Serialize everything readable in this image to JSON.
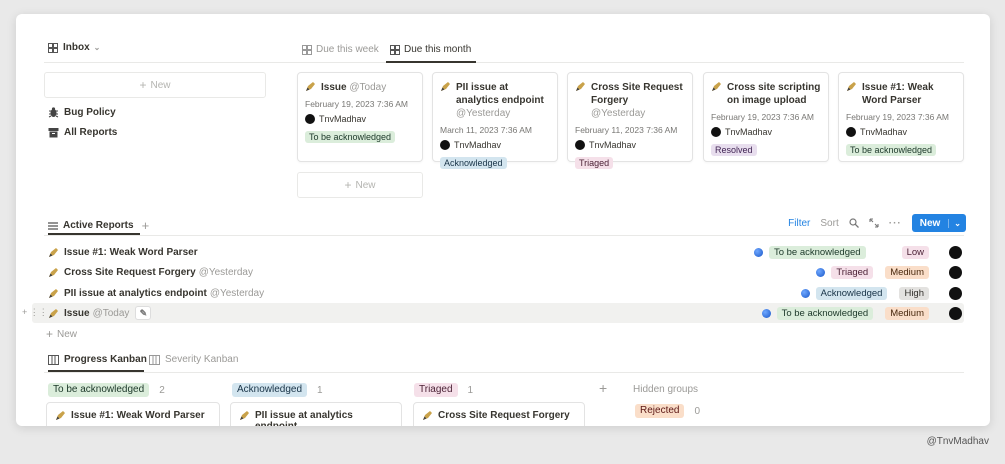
{
  "sidebar": {
    "view": "Inbox",
    "new_label": "New",
    "items": [
      {
        "label": "Bug Policy",
        "icon": "bug-icon"
      },
      {
        "label": "All Reports",
        "icon": "archive-box-icon"
      }
    ]
  },
  "due_tabs": [
    {
      "label": "Due this week",
      "active": false
    },
    {
      "label": "Due this month",
      "active": true
    }
  ],
  "cards": [
    {
      "title": "Issue",
      "mention": "@Today",
      "date": "February 19, 2023 7:36 AM",
      "user": "TnvMadhav",
      "tag": "To be acknowledged"
    },
    {
      "title": "PII issue at analytics endpoint",
      "mention": "@Yesterday",
      "date": "March 11, 2023 7:36 AM",
      "user": "TnvMadhav",
      "tag": "Acknowledged"
    },
    {
      "title": "Cross Site Request Forgery",
      "mention": "@Yesterday",
      "date": "February 11, 2023 7:36 AM",
      "user": "TnvMadhav",
      "tag": "Triaged"
    },
    {
      "title": "Cross site scripting on image upload",
      "mention": "",
      "date": "February 19, 2023 7:36 AM",
      "user": "TnvMadhav",
      "tag": "Resolved"
    },
    {
      "title": "Issue #1: Weak Word Parser",
      "mention": "",
      "date": "February 19, 2023 7:36 AM",
      "user": "TnvMadhav",
      "tag": "To be acknowledged"
    }
  ],
  "cards_new_label": "New",
  "active_reports": {
    "title": "Active Reports",
    "filter": "Filter",
    "sort": "Sort",
    "new_button": "New",
    "rows": [
      {
        "name": "Issue #1: Weak Word Parser",
        "mention": "",
        "status": "To be acknowledged",
        "severity": "Low"
      },
      {
        "name": "Cross Site Request Forgery",
        "mention": "@Yesterday",
        "status": "Triaged",
        "severity": "Medium"
      },
      {
        "name": "PII issue at analytics endpoint",
        "mention": "@Yesterday",
        "status": "Acknowledged",
        "severity": "High"
      },
      {
        "name": "Issue",
        "mention": "@Today",
        "status": "To be acknowledged",
        "severity": "Medium"
      }
    ],
    "new_row_label": "New"
  },
  "kanban_tabs": [
    {
      "label": "Progress Kanban",
      "active": true
    },
    {
      "label": "Severity Kanban",
      "active": false
    }
  ],
  "kanban": {
    "groups": [
      {
        "label": "To be acknowledged",
        "count": "2",
        "card": "Issue #1: Weak Word Parser"
      },
      {
        "label": "Acknowledged",
        "count": "1",
        "card": "PII issue at analytics endpoint"
      },
      {
        "label": "Triaged",
        "count": "1",
        "card": "Cross Site Request Forgery"
      }
    ],
    "hidden_groups_label": "Hidden groups",
    "hidden": [
      {
        "label": "Rejected",
        "count": "0"
      }
    ]
  },
  "watermark": "@TnvMadhav",
  "colors": {
    "accent": "#2383e2",
    "filter": "#2383e2"
  }
}
